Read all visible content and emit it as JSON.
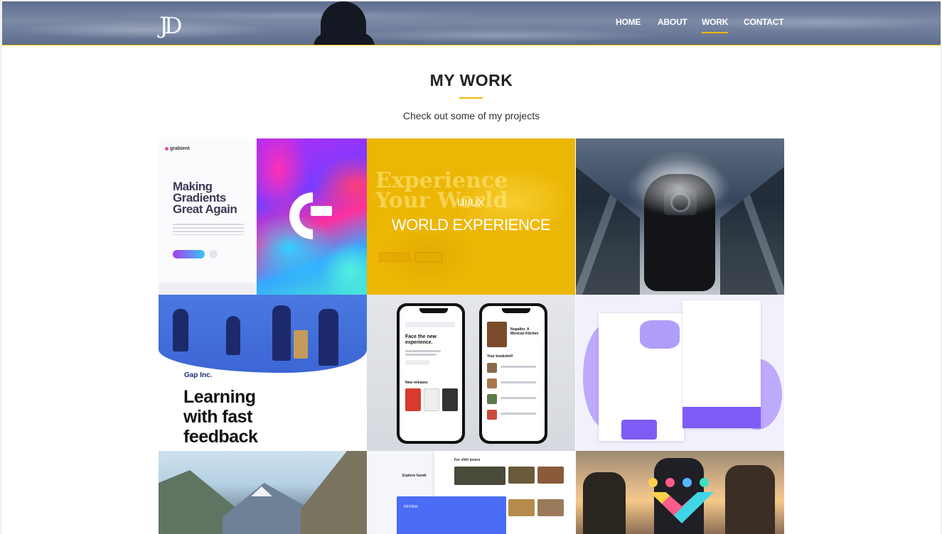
{
  "header": {
    "logo_text": "JD",
    "nav": [
      {
        "label": "HOME",
        "active": false
      },
      {
        "label": "ABOUT",
        "active": false
      },
      {
        "label": "WORK",
        "active": true
      },
      {
        "label": "CONTACT",
        "active": false
      }
    ],
    "accent_color": "#f0b90b"
  },
  "section": {
    "title": "MY WORK",
    "subtitle": "Check out some of my projects"
  },
  "projects": [
    {
      "name": "grabient",
      "brand": "grabient",
      "headline": "Making Gradients Great Again"
    },
    {
      "name": "world-experience",
      "ghost_text_1": "Experience",
      "ghost_text_2": "Your World",
      "category": "UI/UX",
      "headline": "WORLD EXPERIENCE"
    },
    {
      "name": "photographer"
    },
    {
      "name": "gap-learning",
      "brand": "Gap Inc.",
      "headline_1": "Learning",
      "headline_2": "with fast",
      "headline_3": "feedback"
    },
    {
      "name": "book-app",
      "phone1_title": "Face the new experience.",
      "phone1_section": "New releases",
      "phone2_title": "Nopalito: A Mexican Kitchen",
      "phone2_section": "Your bookshelf"
    },
    {
      "name": "purple-landing"
    },
    {
      "name": "mountains"
    },
    {
      "name": "food-app",
      "heading": "For chfri lovers",
      "side_heading": "Explore hundr",
      "card_label": "REVIEW"
    },
    {
      "name": "friends-heart"
    }
  ]
}
